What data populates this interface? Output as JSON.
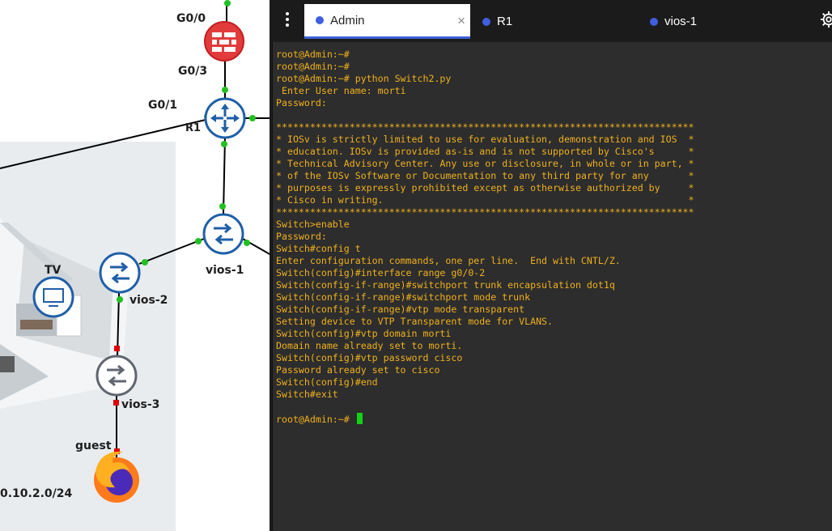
{
  "topology": {
    "interfaces": {
      "g0_0": "G0/0",
      "g0_3": "G0/3",
      "g0_1": "G0/1"
    },
    "nodes": {
      "r1": "R1",
      "vios1": "vios-1",
      "vios2": "vios-2",
      "vios3": "vios-3",
      "guest": "guest",
      "tv": "TV"
    },
    "subnet": "0.10.2.0/24",
    "colors": {
      "router": "#1f5fa8",
      "firewall": "#e23b3b",
      "link_up": "#22c022",
      "link_down": "#e00000"
    }
  },
  "terminal": {
    "menu_icon": "vertical-dots-icon",
    "settings_icon": "gear-icon",
    "tabs": [
      {
        "label": "Admin",
        "close": "×",
        "active": true
      },
      {
        "label": "R1",
        "active": false
      },
      {
        "label": "vios-1",
        "active": false
      }
    ],
    "lines": [
      "root@Admin:~#",
      "root@Admin:~#",
      "root@Admin:~# python Switch2.py",
      " Enter User name: morti",
      "Password:",
      "",
      "**************************************************************************",
      "* IOSv is strictly limited to use for evaluation, demonstration and IOS  *",
      "* education. IOSv is provided as-is and is not supported by Cisco's      *",
      "* Technical Advisory Center. Any use or disclosure, in whole or in part, *",
      "* of the IOSv Software or Documentation to any third party for any       *",
      "* purposes is expressly prohibited except as otherwise authorized by     *",
      "* Cisco in writing.                                                      *",
      "**************************************************************************",
      "Switch>enable",
      "Password:",
      "Switch#config t",
      "Enter configuration commands, one per line.  End with CNTL/Z.",
      "Switch(config)#interface range g0/0-2",
      "Switch(config-if-range)#switchport trunk encapsulation dot1q",
      "Switch(config-if-range)#switchport mode trunk",
      "Switch(config-if-range)#vtp mode transparent",
      "Setting device to VTP Transparent mode for VLANS.",
      "Switch(config)#vtp domain morti",
      "Domain name already set to morti.",
      "Switch(config)#vtp password cisco",
      "Password already set to cisco",
      "Switch(config)#end",
      "Switch#exit",
      "",
      "root@Admin:~# "
    ]
  }
}
